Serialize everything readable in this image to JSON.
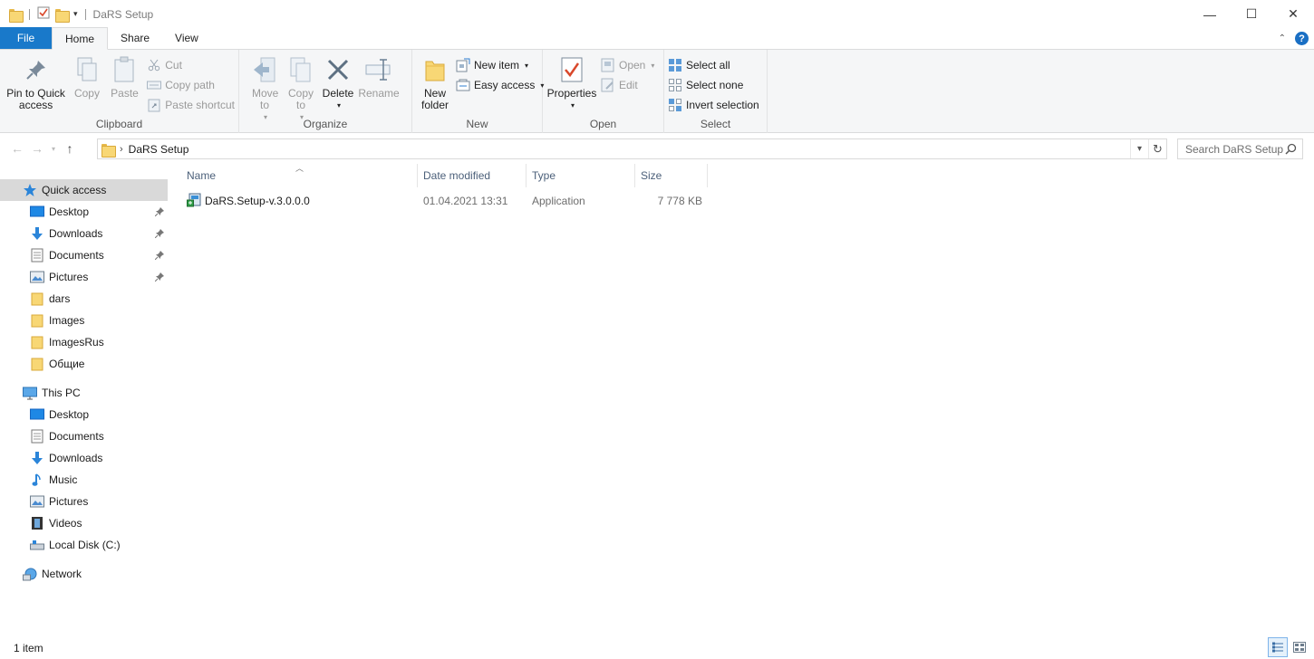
{
  "window": {
    "title": "DaRS Setup",
    "minimize": "—",
    "maximize": "☐",
    "close": "✕"
  },
  "ribbon_tabs": [
    "File",
    "Home",
    "Share",
    "View"
  ],
  "ribbon": {
    "clipboard": {
      "label": "Clipboard",
      "pin": "Pin to Quick access",
      "copy": "Copy",
      "paste": "Paste",
      "cut": "Cut",
      "copy_path": "Copy path",
      "paste_shortcut": "Paste shortcut"
    },
    "organize": {
      "label": "Organize",
      "move_to": "Move to",
      "copy_to": "Copy to",
      "delete": "Delete",
      "rename": "Rename"
    },
    "new": {
      "label": "New",
      "new_folder": "New folder",
      "new_item": "New item",
      "easy_access": "Easy access"
    },
    "open": {
      "label": "Open",
      "properties": "Properties",
      "open": "Open",
      "edit": "Edit"
    },
    "select": {
      "label": "Select",
      "select_all": "Select all",
      "select_none": "Select none",
      "invert_selection": "Invert selection"
    }
  },
  "address": {
    "path": "DaRS Setup",
    "search_placeholder": "Search DaRS Setup"
  },
  "nav": {
    "quick_access": "Quick access",
    "quick_items": [
      "Desktop",
      "Downloads",
      "Documents",
      "Pictures",
      "dars",
      "Images",
      "ImagesRus",
      "Общие"
    ],
    "this_pc": "This PC",
    "pc_items": [
      "Desktop",
      "Documents",
      "Downloads",
      "Music",
      "Pictures",
      "Videos",
      "Local Disk (C:)"
    ],
    "network": "Network"
  },
  "columns": [
    "Name",
    "Date modified",
    "Type",
    "Size"
  ],
  "files": [
    {
      "name": "DaRS.Setup-v.3.0.0.0",
      "date": "01.04.2021 13:31",
      "type": "Application",
      "size": "7 778 KB"
    }
  ],
  "status": {
    "count": "1 item"
  },
  "colors": {
    "file_tab": "#1979ca",
    "selected_nav": "#d9d9d9",
    "header_text": "#4c607a"
  }
}
